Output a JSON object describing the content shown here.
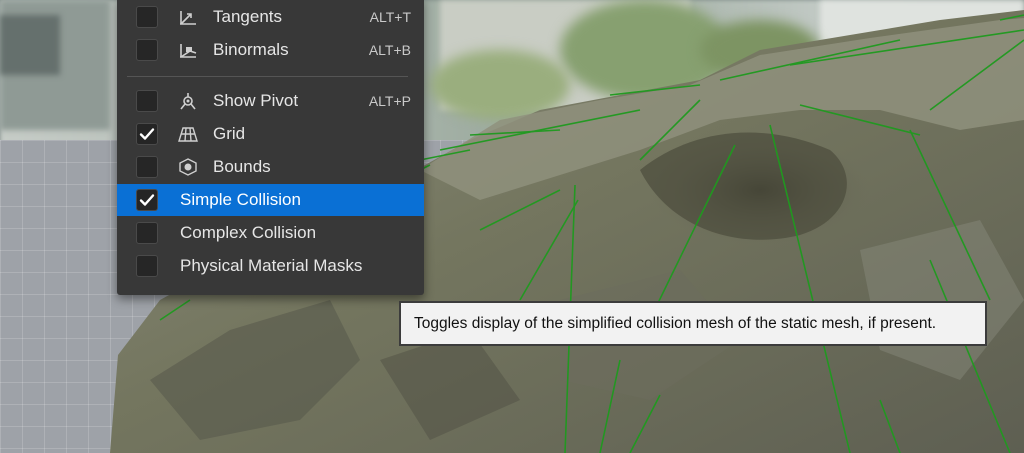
{
  "menu": {
    "items": [
      {
        "label": "Tangents",
        "shortcut": "ALT+T",
        "icon": "tangents-icon",
        "checked": false
      },
      {
        "label": "Binormals",
        "shortcut": "ALT+B",
        "icon": "binormals-icon",
        "checked": false
      },
      {
        "label": "Show Pivot",
        "shortcut": "ALT+P",
        "icon": "pivot-icon",
        "checked": false
      },
      {
        "label": "Grid",
        "shortcut": "",
        "icon": "grid-icon",
        "checked": true
      },
      {
        "label": "Bounds",
        "shortcut": "",
        "icon": "bounds-icon",
        "checked": false
      },
      {
        "label": "Simple Collision",
        "shortcut": "",
        "icon": "",
        "checked": true,
        "highlighted": true
      },
      {
        "label": "Complex Collision",
        "shortcut": "",
        "icon": "",
        "checked": false
      },
      {
        "label": "Physical Material Masks",
        "shortcut": "",
        "icon": "",
        "checked": false
      }
    ]
  },
  "tooltip": {
    "text": "Toggles display of the simplified collision mesh of the static mesh, if present."
  },
  "colors": {
    "menu_bg": "#383838",
    "highlight": "#0a70d5",
    "collision_wire": "#1f9a1f"
  }
}
